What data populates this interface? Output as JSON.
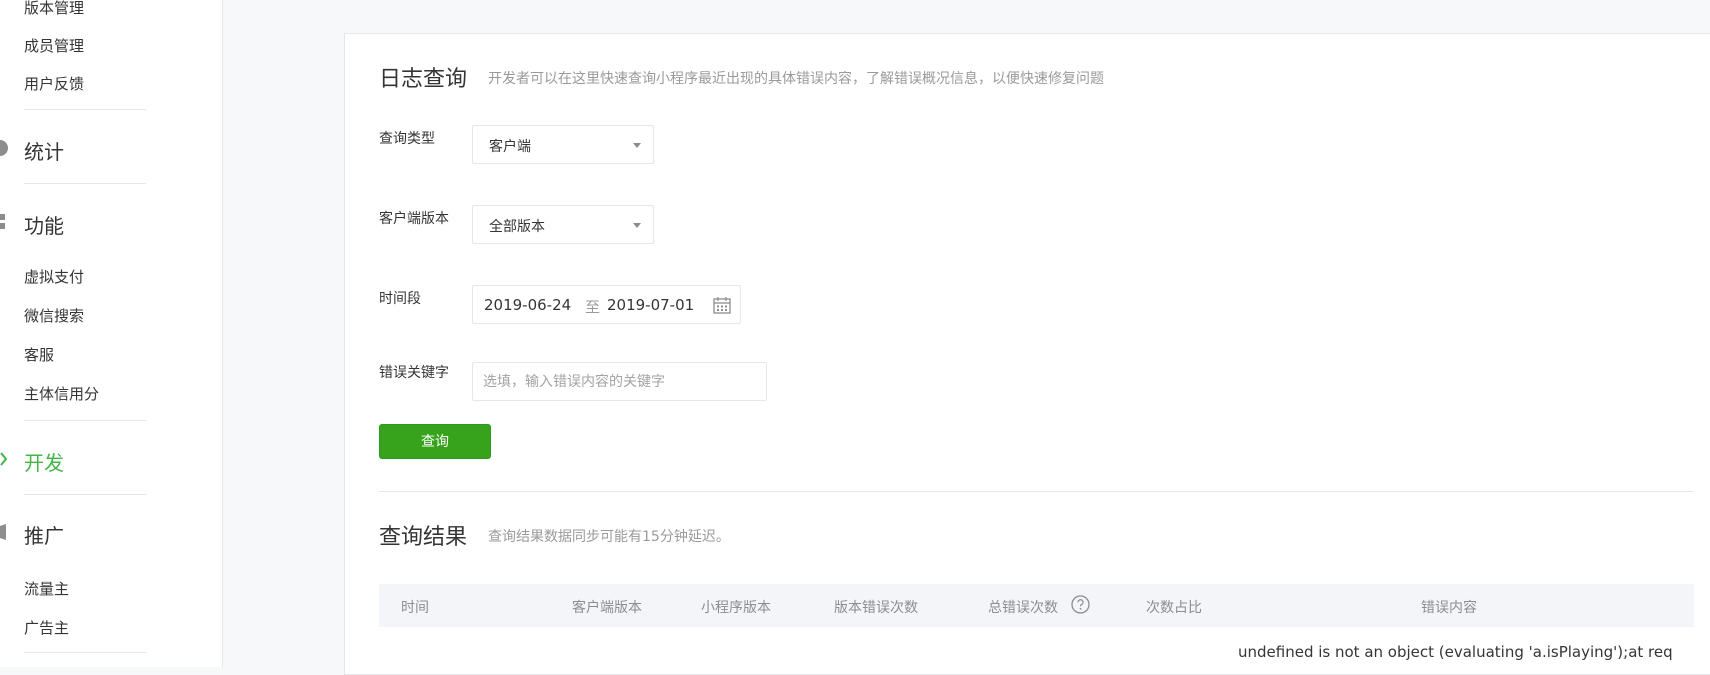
{
  "sidebar": {
    "items": [
      {
        "label": "版本管理"
      },
      {
        "label": "成员管理"
      },
      {
        "label": "用户反馈"
      }
    ],
    "categories": {
      "stats": "统计",
      "features": "功能",
      "develop": "开发",
      "promote": "推广"
    },
    "feature_items": [
      {
        "label": "虚拟支付"
      },
      {
        "label": "微信搜索"
      },
      {
        "label": "客服"
      },
      {
        "label": "主体信用分"
      }
    ],
    "promote_items": [
      {
        "label": "流量主"
      },
      {
        "label": "广告主"
      }
    ],
    "active_color": "#44b549"
  },
  "log_query": {
    "title": "日志查询",
    "description": "开发者可以在这里快速查询小程序最近出现的具体错误内容，了解错误概况信息，以便快速修复问题",
    "query_type_label": "查询类型",
    "query_type_value": "客户端",
    "client_version_label": "客户端版本",
    "client_version_value": "全部版本",
    "time_range_label": "时间段",
    "date_from": "2019-06-24",
    "date_sep": "至",
    "date_to": "2019-07-01",
    "keyword_label": "错误关键字",
    "keyword_placeholder": "选填，输入错误内容的关键字",
    "keyword_value": "",
    "query_button": "查询"
  },
  "results": {
    "title": "查询结果",
    "description": "查询结果数据同步可能有15分钟延迟。",
    "columns": [
      "时间",
      "客户端版本",
      "小程序版本",
      "版本错误次数",
      "总错误次数",
      "次数占比",
      "错误内容"
    ],
    "rows": [
      {
        "error": "undefined is not an object (evaluating 'a.isPlaying');at req"
      }
    ]
  },
  "colors": {
    "primary_button": "#37a21b",
    "accent_green": "#44b549"
  }
}
